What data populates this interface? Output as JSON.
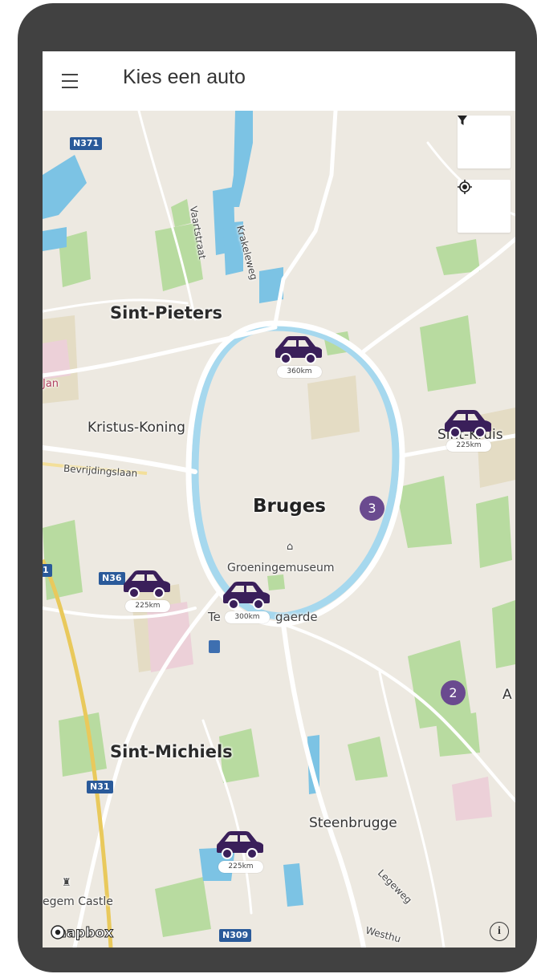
{
  "app": {
    "title": "Kies een auto",
    "menu_icon": "hamburger-menu-icon"
  },
  "map_controls": {
    "filter_icon": "filter-icon",
    "locate_icon": "my-location-icon",
    "info_icon": "info-icon",
    "info_label": "i"
  },
  "attribution": {
    "logo_text": "mapbox"
  },
  "colors": {
    "marker": "#3a1f5a",
    "cluster": "#6a4a8f",
    "water": "#7cc3e4",
    "park": "#b8dba0",
    "land": "#ede9e1",
    "road_shield": "#2a5a9a"
  },
  "places": {
    "sint_pieters": "Sint-Pieters",
    "kristus_koning": "Kristus-Koning",
    "bruges": "Bruges",
    "groeningemuseum": "Groeningemuseum",
    "sint_michiels": "Sint-Michiels",
    "steenbrugge": "Steenbrugge",
    "sint_kruis": "Sint-Kruis",
    "jan": "Jan",
    "a_edge": "A",
    "tempel": "Te",
    "gaerde": "gaerde",
    "castle": "egem Castle"
  },
  "streets": {
    "vaartstraat": "Vaartstraat",
    "krakeleweg": "Krakeleweg",
    "bevrijdingslaan": "Bevrijdingslaan",
    "legeweg": "Legeweg",
    "westhu": "Westhu"
  },
  "road_shields": {
    "n371": "N371",
    "n36": "N36",
    "n31": "N31",
    "n309": "N309",
    "left_edge": "1"
  },
  "cars": [
    {
      "range": "360km"
    },
    {
      "range": "225km"
    },
    {
      "range": "225km"
    },
    {
      "range": "300km"
    },
    {
      "range": "225km"
    }
  ],
  "clusters": [
    {
      "count": "3"
    },
    {
      "count": "2"
    }
  ]
}
